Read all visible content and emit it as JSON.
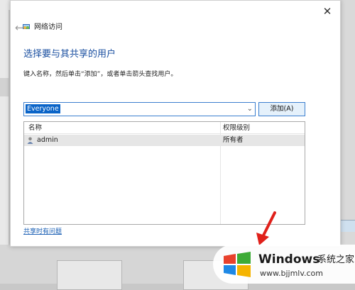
{
  "window": {
    "title": "网络访问",
    "close_glyph": "✕",
    "back_glyph": "←",
    "title_icon": "network-share-icon"
  },
  "main": {
    "heading": "选择要与其共享的用户",
    "hint": "键入名称，然后单击“添加”，或者单击箭头查找用户。",
    "combo": {
      "value": "Everyone",
      "arrow_glyph": "⌄"
    },
    "add_button": "添加(A)",
    "table": {
      "columns": [
        "名称",
        "权限级别"
      ],
      "rows": [
        {
          "name": "admin",
          "permission": "所有者",
          "icon": "user-icon"
        }
      ]
    },
    "help_link": "共享时有问题"
  },
  "watermark": {
    "brand": "Windows",
    "brand_cn": "系统之家",
    "url": "www.bjjmlv.com",
    "colors": {
      "red": "#e8412c",
      "green": "#3eab37",
      "blue": "#1e88e5",
      "yellow": "#f5b400"
    }
  },
  "annotation": {
    "arrow_color": "#e0201a"
  }
}
